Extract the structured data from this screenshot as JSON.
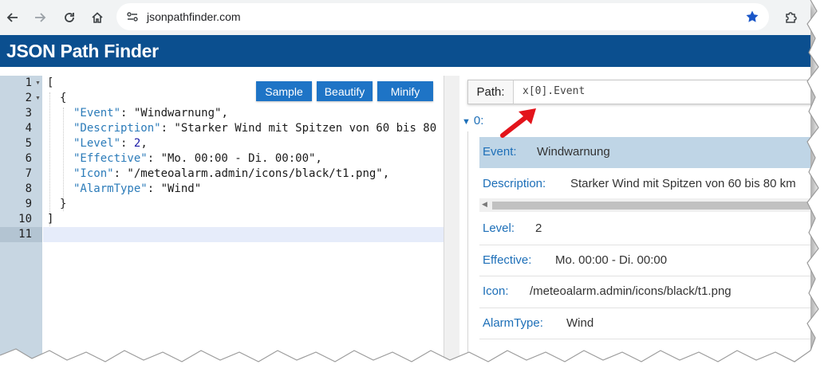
{
  "browser": {
    "url": "jsonpathfinder.com",
    "icons": [
      "back-arrow-icon",
      "forward-arrow-icon",
      "reload-icon",
      "home-icon",
      "site-settings-icon",
      "bookmark-star-icon",
      "extensions-puzzle-icon"
    ]
  },
  "app": {
    "title": "JSON Path Finder",
    "bar_color": "#0b4f8f"
  },
  "editor": {
    "buttons": {
      "sample": "Sample",
      "beautify": "Beautify",
      "minify": "Minify"
    },
    "line_numbers": [
      "1",
      "2",
      "3",
      "4",
      "5",
      "6",
      "7",
      "8",
      "9",
      "10",
      "11"
    ],
    "lines": {
      "l1": "[",
      "l2": "{",
      "l3_key": "\"Event\"",
      "l3_rest": ": \"Windwarnung\",",
      "l4_key": "\"Description\"",
      "l4_rest": ": \"Starker Wind mit Spitzen von 60 bis 80",
      "l5_key": "\"Level\"",
      "l5_colon": ": ",
      "l5_num": "2",
      "l5_end": ",",
      "l6_key": "\"Effective\"",
      "l6_rest": ": \"Mo. 00:00 - Di. 00:00\",",
      "l7_key": "\"Icon\"",
      "l7_rest": ": \"/meteoalarm.admin/icons/black/t1.png\",",
      "l8_key": "\"AlarmType\"",
      "l8_rest": ": \"Wind\"",
      "l9": "}",
      "l10": "]"
    }
  },
  "viewer": {
    "path_label": "Path:",
    "path_value": "x[0].Event",
    "node_label": "0:",
    "rows": [
      {
        "key": "Event:",
        "value": "Windwarnung"
      },
      {
        "key": "Description:",
        "value": "Starker Wind mit Spitzen von 60 bis 80 km"
      },
      {
        "key": "Level:",
        "value": "2"
      },
      {
        "key": "Effective:",
        "value": "Mo. 00:00 - Di. 00:00"
      },
      {
        "key": "Icon:",
        "value": "/meteoalarm.admin/icons/black/t1.png"
      },
      {
        "key": "AlarmType:",
        "value": "Wind"
      }
    ]
  },
  "annotation": {
    "color": "#e3141b"
  }
}
